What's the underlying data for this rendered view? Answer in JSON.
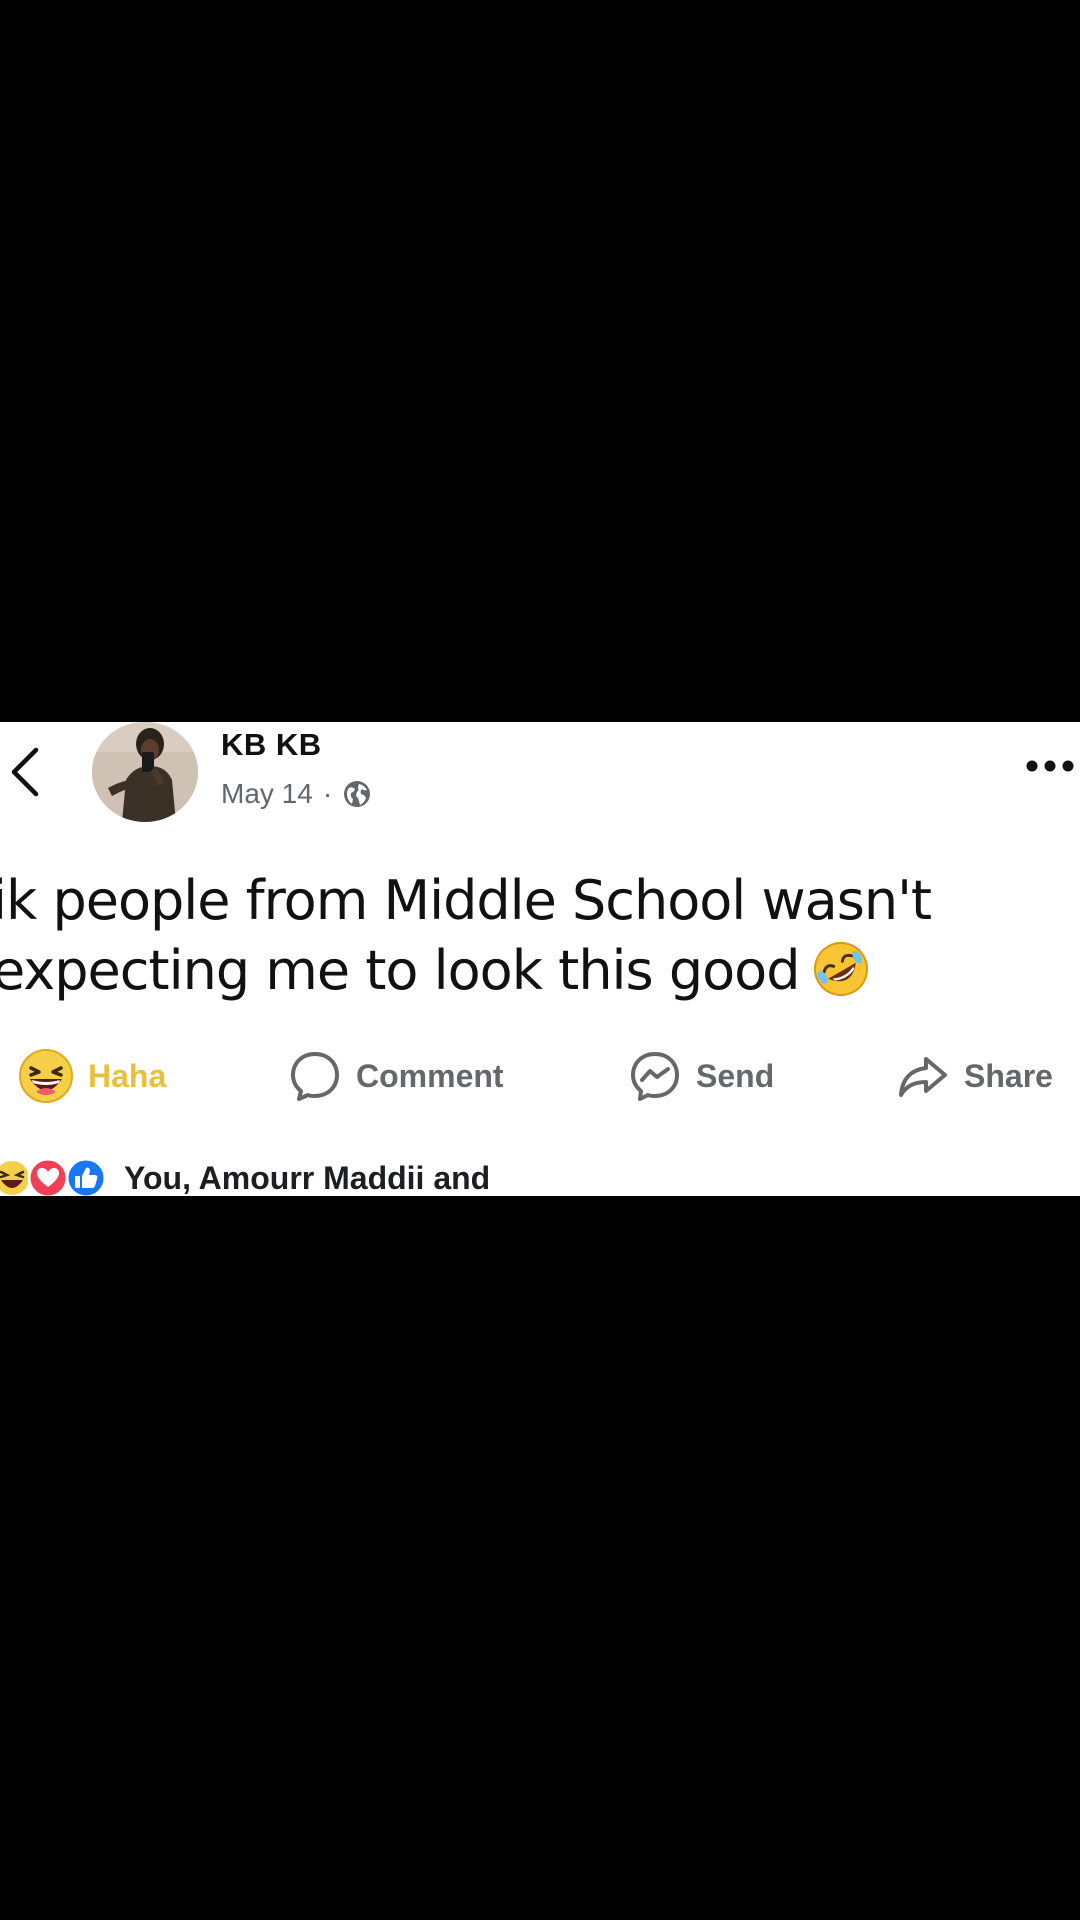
{
  "post": {
    "author": "KB KB",
    "date": "May 14",
    "separator": "·",
    "privacy_icon": "globe-icon",
    "text": "ik people from Middle School wasn't\nexpecting me to look this good",
    "text_emoji_icon": "rolling-on-floor-laughing-icon"
  },
  "actions": {
    "haha_label": "Haha",
    "comment_label": "Comment",
    "send_label": "Send",
    "share_label": "Share",
    "haha_color": "#e7c13c"
  },
  "reactions": {
    "icons": [
      "haha-icon",
      "love-icon",
      "like-icon"
    ],
    "summary": "You, Amourr Maddii and"
  },
  "colors": {
    "background": "#000000",
    "card": "#ffffff",
    "like_blue": "#1877f2",
    "love_pink": "#f33e58"
  }
}
